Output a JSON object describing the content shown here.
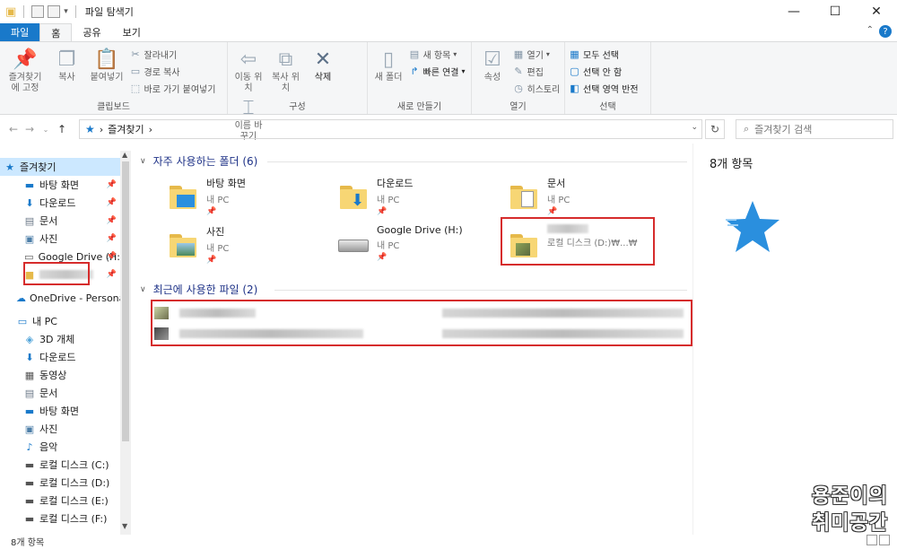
{
  "window": {
    "title": "파일 탐색기",
    "controls": [
      "—",
      "☐",
      "✕"
    ]
  },
  "ribbon_tabs": [
    "파일",
    "홈",
    "공유",
    "보기"
  ],
  "ribbon": {
    "clipboard": {
      "pin_label": "즐겨찾기에 고정",
      "copy_label": "복사",
      "paste_label": "붙여넣기",
      "cut_label": "잘라내기",
      "copy_path_label": "경로 복사",
      "paste_shortcut_label": "바로 가기 붙여넣기",
      "group_label": "클립보드"
    },
    "organize": {
      "move_label": "이동 위치",
      "copy_to_label": "복사 위치",
      "delete_label": "삭제",
      "rename_label": "이름 바꾸기",
      "group_label": "구성"
    },
    "new": {
      "new_folder_label": "새 폴더",
      "new_item_label": "새 항목",
      "easy_access_label": "빠른 연결",
      "group_label": "새로 만들기"
    },
    "open": {
      "properties_label": "속성",
      "open_label": "열기",
      "edit_label": "편집",
      "history_label": "히스토리",
      "group_label": "열기"
    },
    "select": {
      "select_all_label": "모두 선택",
      "select_none_label": "선택 안 함",
      "invert_label": "선택 영역 반전",
      "group_label": "선택"
    }
  },
  "address": {
    "path": "즐겨찾기",
    "separator": "›",
    "search_placeholder": "즐겨찾기 검색"
  },
  "nav": {
    "items": [
      {
        "label": "즐겨찾기",
        "icon": "star-icon"
      },
      {
        "label": "바탕 화면",
        "icon": "desktop-icon"
      },
      {
        "label": "다운로드",
        "icon": "download-icon"
      },
      {
        "label": "문서",
        "icon": "document-icon"
      },
      {
        "label": "사진",
        "icon": "picture-icon"
      },
      {
        "label": "Google Drive (H:",
        "icon": "drive-icon"
      },
      {
        "label": "",
        "icon": "folder-icon"
      },
      {
        "label": "OneDrive - Personal",
        "icon": "onedrive-icon"
      },
      {
        "label": "내 PC",
        "icon": "pc-icon"
      },
      {
        "label": "3D 개체",
        "icon": "cube-icon"
      },
      {
        "label": "다운로드",
        "icon": "download-icon"
      },
      {
        "label": "동영상",
        "icon": "video-icon"
      },
      {
        "label": "문서",
        "icon": "document-icon"
      },
      {
        "label": "바탕 화면",
        "icon": "desktop-icon"
      },
      {
        "label": "사진",
        "icon": "picture-icon"
      },
      {
        "label": "음악",
        "icon": "music-icon"
      },
      {
        "label": "로컬 디스크 (C:)",
        "icon": "disk-icon"
      },
      {
        "label": "로컬 디스크 (D:)",
        "icon": "disk-icon"
      },
      {
        "label": "로컬 디스크 (E:)",
        "icon": "disk-icon"
      },
      {
        "label": "로컬 디스크 (F:)",
        "icon": "disk-icon"
      }
    ]
  },
  "frequent": {
    "title": "자주 사용하는 폴더 (6)",
    "folders": [
      {
        "name": "바탕 화면",
        "location": "내 PC",
        "pinned": true
      },
      {
        "name": "다운로드",
        "location": "내 PC",
        "pinned": true
      },
      {
        "name": "문서",
        "location": "내 PC",
        "pinned": true
      },
      {
        "name": "사진",
        "location": "내 PC",
        "pinned": true
      },
      {
        "name": "Google Drive (H:)",
        "location": "내 PC",
        "pinned": true
      },
      {
        "name": "",
        "location": "로컬 디스크 (D:)₩...₩",
        "pinned": false
      }
    ]
  },
  "recent": {
    "title": "최근에 사용한 파일 (2)"
  },
  "details": {
    "count": "8개 항목"
  },
  "status": {
    "count": "8개 항목"
  },
  "watermark": {
    "line1": "용준이의",
    "line2": "취미공간"
  },
  "colors": {
    "accent": "#1979ca",
    "highlight": "#d62c2c",
    "selected": "#cce8ff"
  }
}
